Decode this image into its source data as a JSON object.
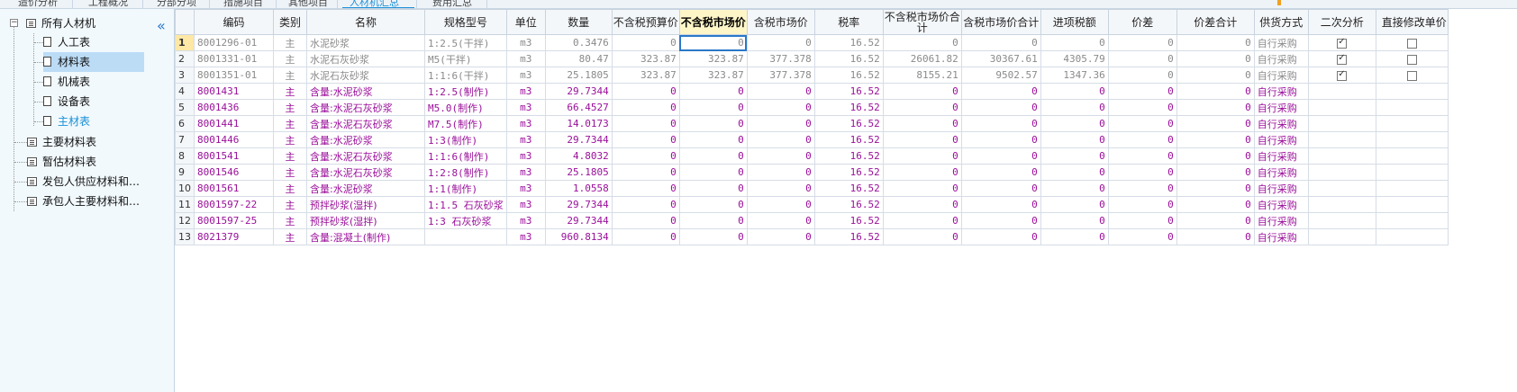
{
  "top_tabs": [
    "造价分析",
    "工程概况",
    "分部分项",
    "措施项目",
    "其他项目",
    "人材机汇总",
    "费用汇总"
  ],
  "tree": {
    "collapse_icon": "double-chevron-left-icon",
    "root": "所有人材机",
    "children": [
      "人工表",
      "材料表",
      "机械表",
      "设备表",
      "主材表"
    ],
    "selected": "材料表",
    "active": "主材表",
    "siblings": [
      "主要材料表",
      "暂估材料表",
      "发包人供应材料和…",
      "承包人主要材料和…"
    ]
  },
  "table": {
    "headers": [
      "",
      "编码",
      "类别",
      "名称",
      "规格型号",
      "单位",
      "数量",
      "不含税预算价",
      "不含税市场价",
      "含税市场价",
      "税率",
      "不含税市场价合计",
      "含税市场价合计",
      "进项税额",
      "价差",
      "价差合计",
      "供货方式",
      "二次分析",
      "直接修改单价"
    ],
    "highlight_header": "不含税市场价",
    "rows": [
      {
        "no": "1",
        "code": "8001296-01",
        "type": "主",
        "name": "水泥砂浆",
        "spec": "1:2.5(干拌)",
        "unit": "m3",
        "qty": "0.3476",
        "budget": "0",
        "market": "0",
        "market_tax": "0",
        "rate": "16.52",
        "market_total": "0",
        "market_tax_total": "0",
        "input_tax": "0",
        "diff": "0",
        "diff_total": "0",
        "supply": "自行采购",
        "analysis": true,
        "direct": false,
        "style": "gray"
      },
      {
        "no": "2",
        "code": "8001331-01",
        "type": "主",
        "name": "水泥石灰砂浆",
        "spec": "M5(干拌)",
        "unit": "m3",
        "qty": "80.47",
        "budget": "323.87",
        "market": "323.87",
        "market_tax": "377.378",
        "rate": "16.52",
        "market_total": "26061.82",
        "market_tax_total": "30367.61",
        "input_tax": "4305.79",
        "diff": "0",
        "diff_total": "0",
        "supply": "自行采购",
        "analysis": true,
        "direct": false,
        "style": "gray"
      },
      {
        "no": "3",
        "code": "8001351-01",
        "type": "主",
        "name": "水泥石灰砂浆",
        "spec": "1:1:6(干拌)",
        "unit": "m3",
        "qty": "25.1805",
        "budget": "323.87",
        "market": "323.87",
        "market_tax": "377.378",
        "rate": "16.52",
        "market_total": "8155.21",
        "market_tax_total": "9502.57",
        "input_tax": "1347.36",
        "diff": "0",
        "diff_total": "0",
        "supply": "自行采购",
        "analysis": true,
        "direct": false,
        "style": "gray"
      },
      {
        "no": "4",
        "code": "8001431",
        "type": "主",
        "name": "含量:水泥砂浆",
        "spec": "1:2.5(制作)",
        "unit": "m3",
        "qty": "29.7344",
        "budget": "0",
        "market": "0",
        "market_tax": "0",
        "rate": "16.52",
        "market_total": "0",
        "market_tax_total": "0",
        "input_tax": "0",
        "diff": "0",
        "diff_total": "0",
        "supply": "自行采购",
        "style": "purple"
      },
      {
        "no": "5",
        "code": "8001436",
        "type": "主",
        "name": "含量:水泥石灰砂浆",
        "spec": "M5.0(制作)",
        "unit": "m3",
        "qty": "66.4527",
        "budget": "0",
        "market": "0",
        "market_tax": "0",
        "rate": "16.52",
        "market_total": "0",
        "market_tax_total": "0",
        "input_tax": "0",
        "diff": "0",
        "diff_total": "0",
        "supply": "自行采购",
        "style": "purple"
      },
      {
        "no": "6",
        "code": "8001441",
        "type": "主",
        "name": "含量:水泥石灰砂浆",
        "spec": "M7.5(制作)",
        "unit": "m3",
        "qty": "14.0173",
        "budget": "0",
        "market": "0",
        "market_tax": "0",
        "rate": "16.52",
        "market_total": "0",
        "market_tax_total": "0",
        "input_tax": "0",
        "diff": "0",
        "diff_total": "0",
        "supply": "自行采购",
        "style": "purple"
      },
      {
        "no": "7",
        "code": "8001446",
        "type": "主",
        "name": "含量:水泥砂浆",
        "spec": "1:3(制作)",
        "unit": "m3",
        "qty": "29.7344",
        "budget": "0",
        "market": "0",
        "market_tax": "0",
        "rate": "16.52",
        "market_total": "0",
        "market_tax_total": "0",
        "input_tax": "0",
        "diff": "0",
        "diff_total": "0",
        "supply": "自行采购",
        "style": "purple"
      },
      {
        "no": "8",
        "code": "8001541",
        "type": "主",
        "name": "含量:水泥石灰砂浆",
        "spec": "1:1:6(制作)",
        "unit": "m3",
        "qty": "4.8032",
        "budget": "0",
        "market": "0",
        "market_tax": "0",
        "rate": "16.52",
        "market_total": "0",
        "market_tax_total": "0",
        "input_tax": "0",
        "diff": "0",
        "diff_total": "0",
        "supply": "自行采购",
        "style": "purple"
      },
      {
        "no": "9",
        "code": "8001546",
        "type": "主",
        "name": "含量:水泥石灰砂浆",
        "spec": "1:2:8(制作)",
        "unit": "m3",
        "qty": "25.1805",
        "budget": "0",
        "market": "0",
        "market_tax": "0",
        "rate": "16.52",
        "market_total": "0",
        "market_tax_total": "0",
        "input_tax": "0",
        "diff": "0",
        "diff_total": "0",
        "supply": "自行采购",
        "style": "purple"
      },
      {
        "no": "10",
        "code": "8001561",
        "type": "主",
        "name": "含量:水泥砂浆",
        "spec": "1:1(制作)",
        "unit": "m3",
        "qty": "1.0558",
        "budget": "0",
        "market": "0",
        "market_tax": "0",
        "rate": "16.52",
        "market_total": "0",
        "market_tax_total": "0",
        "input_tax": "0",
        "diff": "0",
        "diff_total": "0",
        "supply": "自行采购",
        "style": "purple"
      },
      {
        "no": "11",
        "code": "8001597-22",
        "type": "主",
        "name": "预拌砂浆(湿拌)",
        "spec": "1:1.5 石灰砂浆",
        "unit": "m3",
        "qty": "29.7344",
        "budget": "0",
        "market": "0",
        "market_tax": "0",
        "rate": "16.52",
        "market_total": "0",
        "market_tax_total": "0",
        "input_tax": "0",
        "diff": "0",
        "diff_total": "0",
        "supply": "自行采购",
        "style": "purple"
      },
      {
        "no": "12",
        "code": "8001597-25",
        "type": "主",
        "name": "预拌砂浆(湿拌)",
        "spec": "1:3 石灰砂浆",
        "unit": "m3",
        "qty": "29.7344",
        "budget": "0",
        "market": "0",
        "market_tax": "0",
        "rate": "16.52",
        "market_total": "0",
        "market_tax_total": "0",
        "input_tax": "0",
        "diff": "0",
        "diff_total": "0",
        "supply": "自行采购",
        "style": "purple"
      },
      {
        "no": "13",
        "code": "8021379",
        "type": "主",
        "name": "含量:混凝土(制作)",
        "spec": "",
        "unit": "m3",
        "qty": "960.8134",
        "budget": "0",
        "market": "0",
        "market_tax": "0",
        "rate": "16.52",
        "market_total": "0",
        "market_tax_total": "0",
        "input_tax": "0",
        "diff": "0",
        "diff_total": "0",
        "supply": "自行采购",
        "style": "purple"
      }
    ]
  }
}
